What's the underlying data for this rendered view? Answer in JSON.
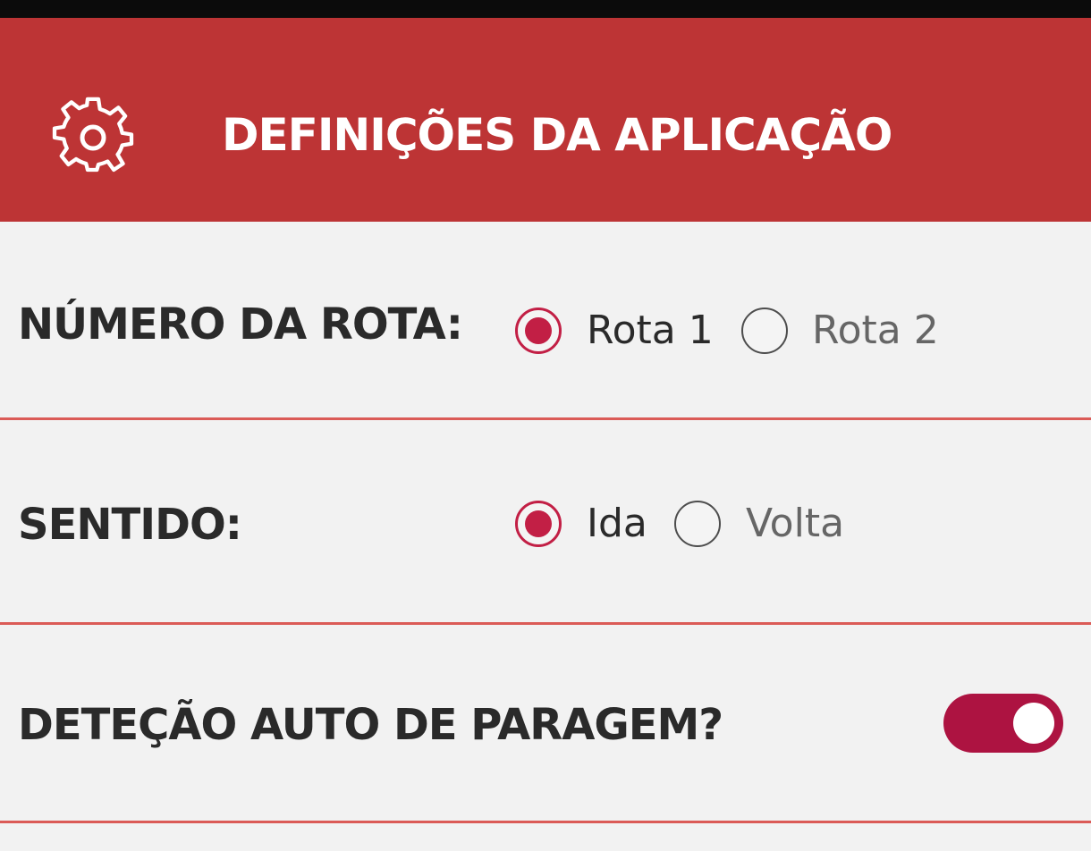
{
  "header": {
    "icon": "gear-icon",
    "title": "DEFINIÇÕES DA APLICAÇÃO",
    "background_color": "#bd3435"
  },
  "settings": {
    "route": {
      "label": "NÚMERO DA ROTA:",
      "options": [
        "Rota 1",
        "Rota 2"
      ],
      "selected": "Rota 1"
    },
    "direction": {
      "label": "SENTIDO:",
      "options": [
        "Ida",
        "Volta"
      ],
      "selected": "Ida"
    },
    "auto_stop_detection": {
      "label": "DETEÇÃO AUTO DE PARAGEM?",
      "enabled": true
    }
  },
  "colors": {
    "accent": "#c21f45",
    "divider": "#db5b57",
    "background": "#f2f2f2"
  }
}
